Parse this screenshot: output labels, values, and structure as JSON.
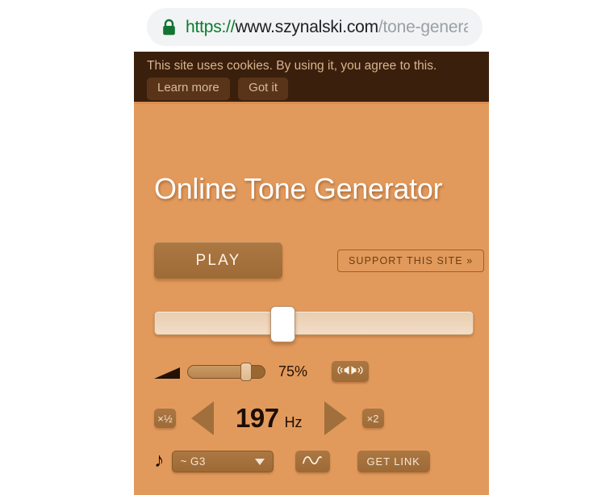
{
  "browser": {
    "lock_icon": "lock-icon",
    "url_scheme": "https://",
    "url_host": "www.szynalski.com",
    "url_path": "/tone-generato"
  },
  "cookie_bar": {
    "message": "This site uses cookies. By using it, you agree to this.",
    "learn_more_label": "Learn more",
    "got_it_label": "Got it"
  },
  "page": {
    "title": "Online Tone Generator",
    "background_color": "#e29a5c",
    "cookie_bar_color": "#3b1f0d",
    "button_color": "#a5703c"
  },
  "controls": {
    "play_label": "PLAY",
    "support_label": "SUPPORT THIS SITE »",
    "frequency_slider": {
      "name": "frequency-slider",
      "thumb_percent": 40
    },
    "volume": {
      "icon": "volume-triangle-icon",
      "percent_label": "75%",
      "percent_value": 75,
      "stereo_icon": "stereo-speakers-icon"
    },
    "frequency": {
      "half_label": "×½",
      "double_label": "×2",
      "decrease_icon": "triangle-left-icon",
      "increase_icon": "triangle-right-icon",
      "value": "197",
      "unit": "Hz"
    },
    "note": {
      "icon": "music-note-icon",
      "selected": "~ G3",
      "caret_icon": "chevron-down-icon",
      "waveform_icon": "sine-wave-icon",
      "get_link_label": "GET LINK"
    }
  }
}
